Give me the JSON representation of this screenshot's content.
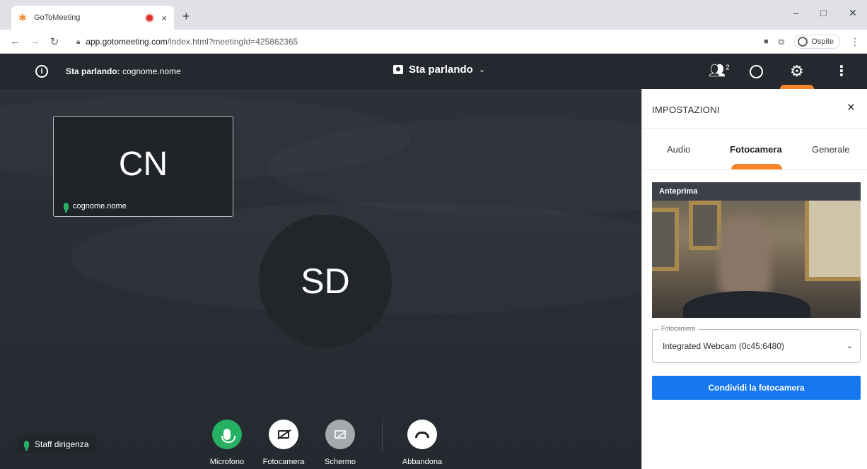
{
  "browser": {
    "tab_title": "GoToMeeting",
    "tab_close": "×",
    "new_tab": "+",
    "url_host": "app.gotomeeting.com",
    "url_path": "/index.html?meetingId=425862365",
    "profile_label": "Ospite",
    "window_minimize": "–",
    "window_restore": "□",
    "window_close": "✕"
  },
  "header": {
    "speaking_prefix": "Sta parlando:",
    "speaking_name": "cognome.nome",
    "view_mode": "Sta parlando",
    "participants_count": "2"
  },
  "stage": {
    "tile": {
      "initials": "CN",
      "name": "cognome.nome"
    },
    "main_avatar_initials": "SD",
    "self_name": "Staff dirigenza",
    "controls": [
      {
        "label": "Microfono"
      },
      {
        "label": "Fotocamera"
      },
      {
        "label": "Schermo"
      },
      {
        "label": "Abbandona"
      }
    ]
  },
  "settings": {
    "title": "IMPOSTAZIONI",
    "close": "×",
    "tabs": [
      "Audio",
      "Fotocamera",
      "Generale"
    ],
    "active_tab": "Fotocamera",
    "preview_title": "Anteprima",
    "camera_field_label": "Fotocamera",
    "camera_value": "Integrated Webcam (0c45:6480)",
    "share_button": "Condividi la fotocamera"
  },
  "colors": {
    "accent_orange": "#f6842a",
    "mic_green": "#25b062",
    "primary_blue": "#1677ee",
    "header_bg": "#25282e"
  }
}
